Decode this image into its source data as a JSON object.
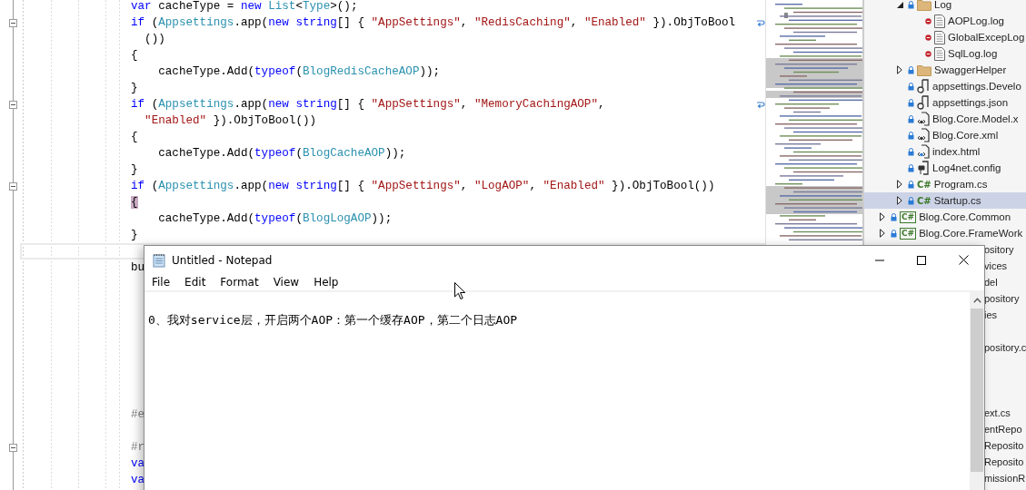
{
  "editor": {
    "lines": [
      {
        "kind": "stmt",
        "tokens": [
          {
            "text": "var",
            "kind": "kw"
          },
          {
            "text": " cacheType = ",
            "kind": "plain"
          },
          {
            "text": "new",
            "kind": "kw"
          },
          {
            "text": " List",
            "kind": "type"
          },
          {
            "text": "<",
            "kind": "plain"
          },
          {
            "text": "Type",
            "kind": "type"
          },
          {
            "text": ">();",
            "kind": "plain"
          }
        ]
      },
      {
        "kind": "stmt",
        "fold": true,
        "wrap": true,
        "tokens": [
          {
            "text": "if",
            "kind": "kw"
          },
          {
            "text": " (",
            "kind": "plain"
          },
          {
            "text": "Appsettings",
            "kind": "type"
          },
          {
            "text": ".app(",
            "kind": "plain"
          },
          {
            "text": "new string",
            "kind": "kw"
          },
          {
            "text": "[] { ",
            "kind": "plain"
          },
          {
            "text": "\"AppSettings\"",
            "kind": "str"
          },
          {
            "text": ", ",
            "kind": "plain"
          },
          {
            "text": "\"RedisCaching\"",
            "kind": "str"
          },
          {
            "text": ", ",
            "kind": "plain"
          },
          {
            "text": "\"Enabled\"",
            "kind": "str"
          },
          {
            "text": " }).ObjToBool",
            "kind": "plain"
          }
        ]
      },
      {
        "kind": "cont",
        "tokens": [
          {
            "text": "())",
            "kind": "plain"
          }
        ]
      },
      {
        "kind": "stmt",
        "tokens": [
          {
            "text": "{",
            "kind": "plain"
          }
        ]
      },
      {
        "kind": "inner",
        "tokens": [
          {
            "text": "cacheType.Add(",
            "kind": "plain"
          },
          {
            "text": "typeof",
            "kind": "kw"
          },
          {
            "text": "(",
            "kind": "plain"
          },
          {
            "text": "BlogRedisCacheAOP",
            "kind": "type"
          },
          {
            "text": "));",
            "kind": "plain"
          }
        ]
      },
      {
        "kind": "stmt",
        "tokens": [
          {
            "text": "}",
            "kind": "plain"
          }
        ]
      },
      {
        "kind": "stmt",
        "fold": true,
        "wrap": true,
        "tokens": [
          {
            "text": "if",
            "kind": "kw"
          },
          {
            "text": " (",
            "kind": "plain"
          },
          {
            "text": "Appsettings",
            "kind": "type"
          },
          {
            "text": ".app(",
            "kind": "plain"
          },
          {
            "text": "new string",
            "kind": "kw"
          },
          {
            "text": "[] { ",
            "kind": "plain"
          },
          {
            "text": "\"AppSettings\"",
            "kind": "str"
          },
          {
            "text": ", ",
            "kind": "plain"
          },
          {
            "text": "\"MemoryCachingAOP\"",
            "kind": "str"
          },
          {
            "text": ",",
            "kind": "plain"
          }
        ]
      },
      {
        "kind": "cont",
        "tokens": [
          {
            "text": "\"Enabled\"",
            "kind": "str"
          },
          {
            "text": " }).ObjToBool())",
            "kind": "plain"
          }
        ]
      },
      {
        "kind": "stmt",
        "tokens": [
          {
            "text": "{",
            "kind": "plain"
          }
        ]
      },
      {
        "kind": "inner",
        "tokens": [
          {
            "text": "cacheType.Add(",
            "kind": "plain"
          },
          {
            "text": "typeof",
            "kind": "kw"
          },
          {
            "text": "(",
            "kind": "plain"
          },
          {
            "text": "BlogCacheAOP",
            "kind": "type"
          },
          {
            "text": "));",
            "kind": "plain"
          }
        ]
      },
      {
        "kind": "stmt",
        "tokens": [
          {
            "text": "}",
            "kind": "plain"
          }
        ]
      },
      {
        "kind": "stmt",
        "fold": true,
        "tokens": [
          {
            "text": "if",
            "kind": "kw"
          },
          {
            "text": " (",
            "kind": "plain"
          },
          {
            "text": "Appsettings",
            "kind": "type"
          },
          {
            "text": ".app(",
            "kind": "plain"
          },
          {
            "text": "new string",
            "kind": "kw"
          },
          {
            "text": "[] { ",
            "kind": "plain"
          },
          {
            "text": "\"AppSettings\"",
            "kind": "str"
          },
          {
            "text": ", ",
            "kind": "plain"
          },
          {
            "text": "\"LogAOP\"",
            "kind": "str"
          },
          {
            "text": ", ",
            "kind": "plain"
          },
          {
            "text": "\"Enabled\"",
            "kind": "str"
          },
          {
            "text": " }).ObjToBool())",
            "kind": "plain"
          }
        ]
      },
      {
        "kind": "stmt",
        "tokens": [
          {
            "text": "{",
            "kind": "match"
          }
        ]
      },
      {
        "kind": "inner",
        "tokens": [
          {
            "text": "cacheType.Add(",
            "kind": "plain"
          },
          {
            "text": "typeof",
            "kind": "kw"
          },
          {
            "text": "(",
            "kind": "plain"
          },
          {
            "text": "BlogLogAOP",
            "kind": "type"
          },
          {
            "text": "));",
            "kind": "plain"
          }
        ]
      },
      {
        "kind": "stmt",
        "tokens": [
          {
            "text": "}",
            "kind": "plain"
          }
        ]
      },
      {
        "kind": "current"
      },
      {
        "kind": "stmt",
        "tokens": [
          {
            "text": "bu",
            "kind": "plain"
          }
        ]
      },
      {
        "kind": "blank"
      },
      {
        "kind": "blank"
      },
      {
        "kind": "blank"
      },
      {
        "kind": "blank"
      },
      {
        "kind": "blank"
      },
      {
        "kind": "blank"
      },
      {
        "kind": "blank"
      },
      {
        "kind": "blank"
      },
      {
        "kind": "stmt",
        "tokens": [
          {
            "text": "#e",
            "kind": "pre"
          }
        ]
      },
      {
        "kind": "blank"
      },
      {
        "kind": "stmt",
        "fold": true,
        "tokens": [
          {
            "text": "#r",
            "kind": "pre"
          }
        ]
      },
      {
        "kind": "stmt",
        "tokens": [
          {
            "text": "va",
            "kind": "kw"
          }
        ]
      },
      {
        "kind": "stmt",
        "tokens": [
          {
            "text": "va",
            "kind": "kw"
          }
        ]
      }
    ]
  },
  "solution_explorer": {
    "project_items": [
      {
        "label": "Log",
        "kind": "folder",
        "expanded": true,
        "selected": false,
        "children": [
          {
            "label": "AOPLog.log",
            "kind": "log-file",
            "selected": false
          },
          {
            "label": "GlobalExcepLog",
            "kind": "log-file",
            "selected": false
          },
          {
            "label": "SqlLog.log",
            "kind": "log-file",
            "selected": false
          }
        ]
      },
      {
        "label": "SwaggerHelper",
        "kind": "folder",
        "expanded": false,
        "selected": false
      },
      {
        "label": "appsettings.Develo",
        "kind": "settings-file",
        "selected": false
      },
      {
        "label": "appsettings.json",
        "kind": "settings-file",
        "selected": false
      },
      {
        "label": "Blog.Core.Model.x",
        "kind": "xml-file",
        "selected": false
      },
      {
        "label": "Blog.Core.xml",
        "kind": "xml-file",
        "selected": false
      },
      {
        "label": "index.html",
        "kind": "html-file",
        "selected": false
      },
      {
        "label": "Log4net.config",
        "kind": "config-file",
        "selected": false
      },
      {
        "label": "Program.cs",
        "kind": "cs-file",
        "icon_text": "C#",
        "expanded": false,
        "selected": false
      },
      {
        "label": "Startup.cs",
        "kind": "cs-file",
        "icon_text": "C#",
        "expanded": false,
        "selected": true
      }
    ],
    "projects": [
      {
        "label": "Blog.Core.Common",
        "icon_text": "C#",
        "expanded": false,
        "selected": false
      },
      {
        "label": "Blog.Core.FrameWork",
        "icon_text": "C#",
        "expanded": false,
        "selected": false
      }
    ],
    "clipped_rows": [
      {
        "kind": "text",
        "label": "ository"
      },
      {
        "kind": "text",
        "label": "vices"
      },
      {
        "kind": "text",
        "label": "del"
      },
      {
        "kind": "text",
        "label": "pository"
      },
      {
        "kind": "text",
        "label": "ies"
      },
      {
        "kind": "covered"
      },
      {
        "kind": "text",
        "label": "pository.c"
      },
      {
        "kind": "covered"
      },
      {
        "kind": "covered"
      },
      {
        "kind": "covered"
      },
      {
        "kind": "text",
        "label": "ext.cs"
      },
      {
        "kind": "text",
        "label": "entRepo"
      },
      {
        "kind": "text",
        "label": "Reposito"
      },
      {
        "kind": "text",
        "label": "Reposito"
      },
      {
        "kind": "text",
        "label": "missionR"
      }
    ]
  },
  "notepad": {
    "title": "Untitled - Notepad",
    "menu": [
      "File",
      "Edit",
      "Format",
      "View",
      "Help"
    ],
    "text": "0、我对service层，开启两个AOP：第一个缓存AOP，第二个日志AOP"
  }
}
